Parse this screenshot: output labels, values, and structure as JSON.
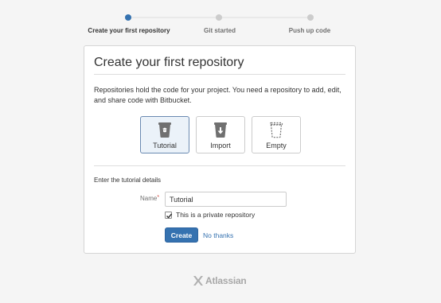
{
  "stepper": {
    "steps": [
      {
        "label": "Create your first repository",
        "active": true
      },
      {
        "label": "Git started",
        "active": false
      },
      {
        "label": "Push up code",
        "active": false
      }
    ]
  },
  "card": {
    "title": "Create your first repository",
    "description": "Repositories hold the code for your project. You need a repository to add, edit, and share code with Bitbucket.",
    "tiles": [
      {
        "label": "Tutorial",
        "icon": "tutorial-repo-icon",
        "selected": true
      },
      {
        "label": "Import",
        "icon": "import-repo-icon",
        "selected": false
      },
      {
        "label": "Empty",
        "icon": "empty-repo-icon",
        "selected": false
      }
    ],
    "section_label": "Enter the tutorial details",
    "name_field": {
      "label": "Name",
      "required_marker": "*",
      "value": "Tutorial"
    },
    "private_checkbox": {
      "label": "This is a private repository",
      "checked": true
    },
    "create_button": "Create",
    "no_thanks_link": "No thanks"
  },
  "footer": {
    "logo_text": "Atlassian"
  },
  "colors": {
    "accent": "#3572b0",
    "tile_selected_bg": "#ebf2f9",
    "page_bg": "#f5f5f5",
    "required": "#d04437"
  }
}
